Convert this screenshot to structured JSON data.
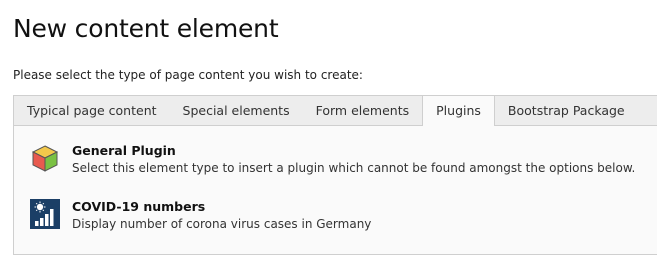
{
  "page": {
    "title": "New content element",
    "intro": "Please select the type of page content you wish to create:"
  },
  "tabs": [
    {
      "label": "Typical page content",
      "active": false
    },
    {
      "label": "Special elements",
      "active": false
    },
    {
      "label": "Form elements",
      "active": false
    },
    {
      "label": "Plugins",
      "active": true
    },
    {
      "label": "Bootstrap Package",
      "active": false
    }
  ],
  "items": [
    {
      "title": "General Plugin",
      "description": "Select this element type to insert a plugin which cannot be found amongst the options below.",
      "icon": "plugin-cube-icon"
    },
    {
      "title": "COVID-19 numbers",
      "description": "Display number of corona virus cases in Germany",
      "icon": "covid-chart-icon"
    }
  ],
  "colors": {
    "tab_bar": "#ededed",
    "panel": "#fafafa",
    "border": "#cfcfcf",
    "covid_icon_bg": "#1b3f66"
  }
}
